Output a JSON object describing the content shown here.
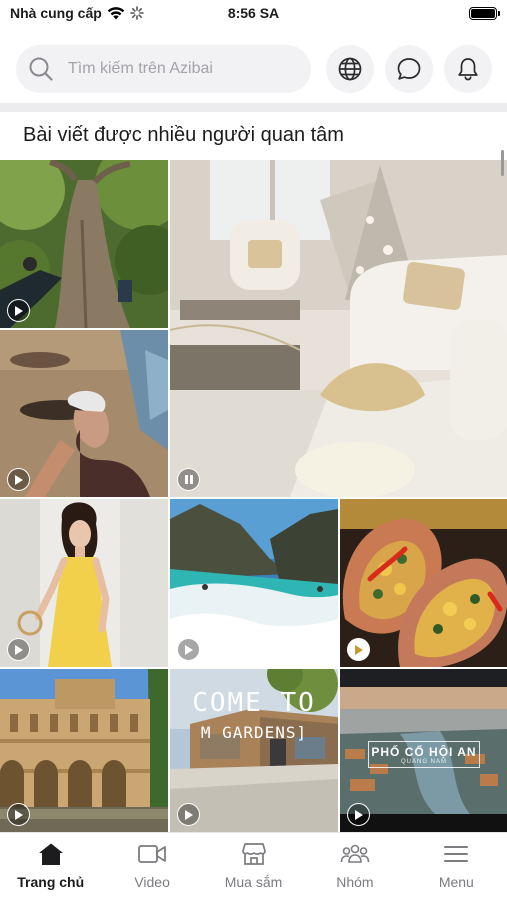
{
  "status_bar": {
    "carrier": "Nhà cung cấp",
    "time": "8:56 SA"
  },
  "header": {
    "search_placeholder": "Tìm kiếm trên Azibai",
    "buttons": [
      "globe-icon",
      "chat-bubble-icon",
      "bell-icon"
    ]
  },
  "section": {
    "title": "Bài viết được nhiều người quan tâm"
  },
  "posts": [
    {
      "name": "tree-climbing",
      "media": "video"
    },
    {
      "name": "living-room-christmas",
      "media": "video",
      "state": "playing"
    },
    {
      "name": "beach-selfie",
      "media": "video"
    },
    {
      "name": "yellow-dress-model",
      "media": "video"
    },
    {
      "name": "sea-cliffs",
      "media": "video"
    },
    {
      "name": "stuffed-squid-dish",
      "media": "video"
    },
    {
      "name": "palace-courtyard",
      "media": "video"
    },
    {
      "name": "garden-house",
      "media": "video",
      "overlay_text": [
        "COME TO",
        "M GARDENS]"
      ]
    },
    {
      "name": "hoi-an-aerial",
      "media": "video",
      "overlay_text": [
        "PHỐ CỔ HỘI AN",
        "QUẢNG NAM"
      ]
    }
  ],
  "tabs": [
    {
      "label": "Trang chủ",
      "icon": "home-icon",
      "active": true
    },
    {
      "label": "Video",
      "icon": "video-icon",
      "active": false
    },
    {
      "label": "Mua sắm",
      "icon": "shop-icon",
      "active": false
    },
    {
      "label": "Nhóm",
      "icon": "group-icon",
      "active": false
    },
    {
      "label": "Menu",
      "icon": "menu-icon",
      "active": false
    }
  ],
  "colors": {
    "search_bg": "#f2f2f4",
    "active_tab": "#1c1c1e",
    "inactive_tab": "#7b7b80"
  }
}
